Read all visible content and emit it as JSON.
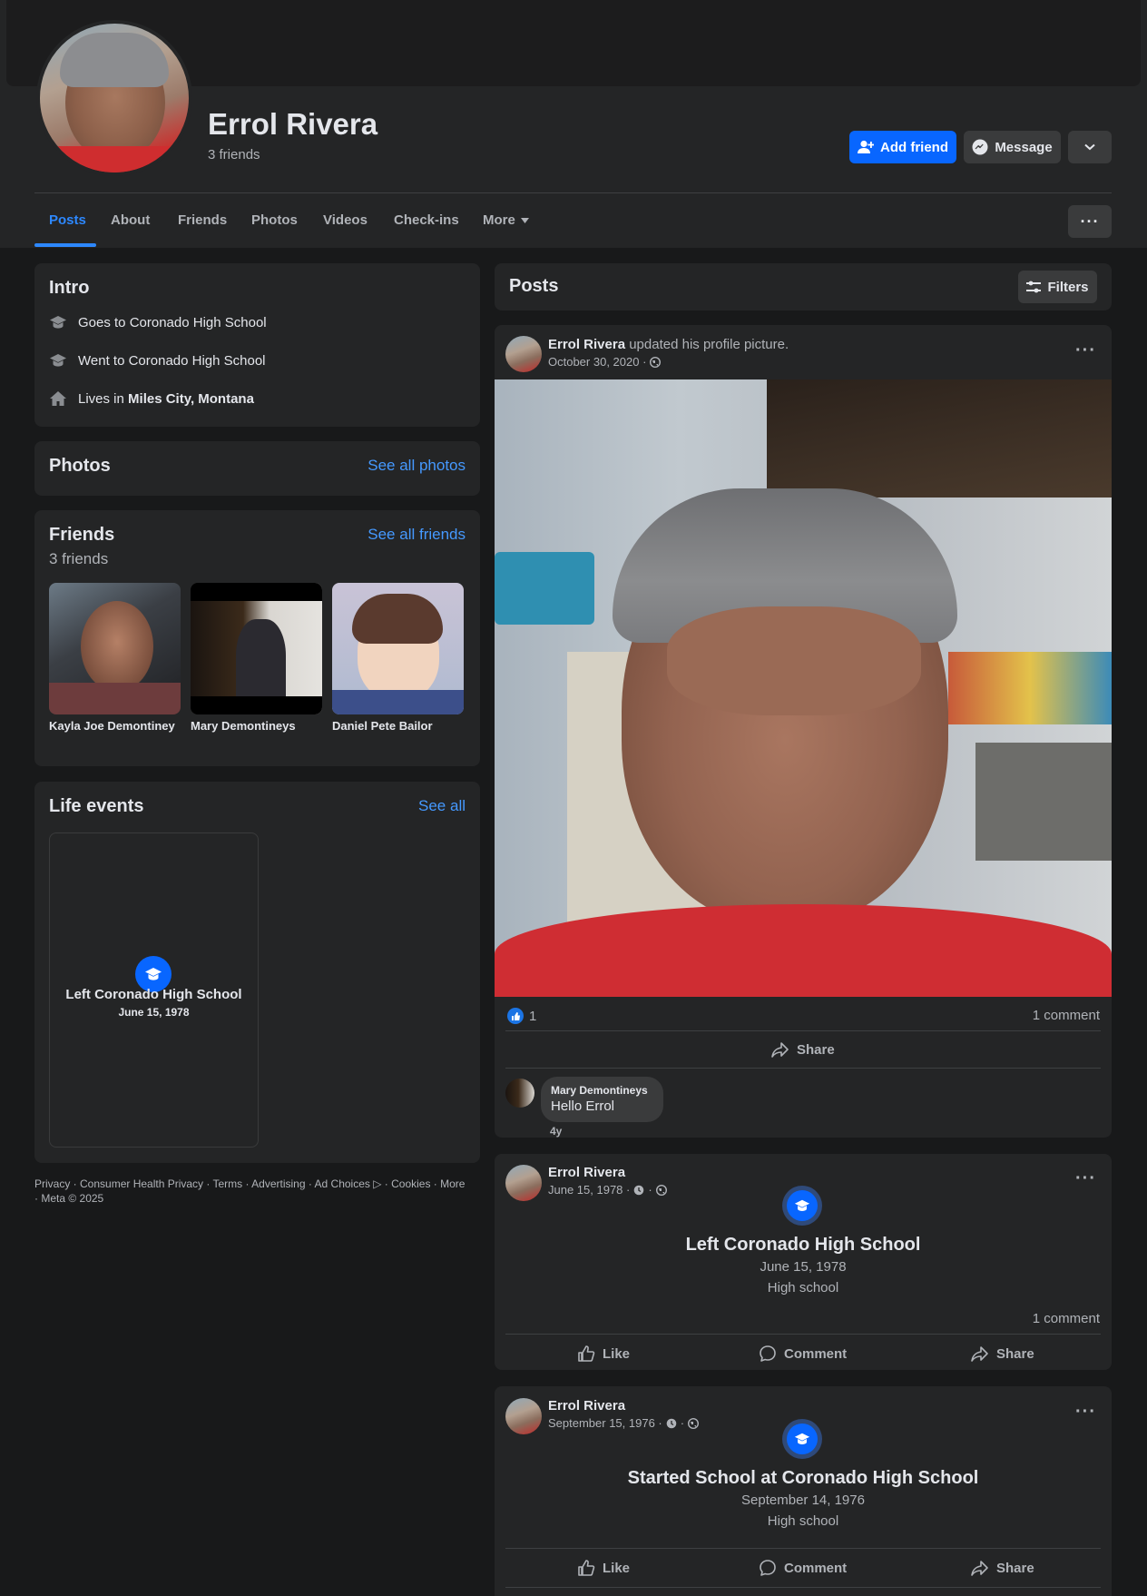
{
  "profile": {
    "name": "Errol Rivera",
    "friends_count": "3 friends"
  },
  "actions": {
    "add_friend": "Add friend",
    "message": "Message"
  },
  "tabs": [
    "Posts",
    "About",
    "Friends",
    "Photos",
    "Videos",
    "Check-ins",
    "More"
  ],
  "intro": {
    "title": "Intro",
    "items": [
      {
        "icon": "graduation-cap-icon",
        "text": "Goes to Coronado High School"
      },
      {
        "icon": "graduation-cap-icon",
        "text": "Went to Coronado High School"
      },
      {
        "icon": "home-icon",
        "prefix": "Lives in ",
        "bold": "Miles City, Montana"
      }
    ]
  },
  "photos": {
    "title": "Photos",
    "link": "See all photos"
  },
  "friends": {
    "title": "Friends",
    "link": "See all friends",
    "count": "3 friends",
    "list": [
      "Kayla Joe Demontiney",
      "Mary Demontineys",
      "Daniel Pete Bailor"
    ]
  },
  "life_events": {
    "title": "Life events",
    "link": "See all",
    "event_title": "Left Coronado High School",
    "event_date": "June 15, 1978"
  },
  "footer": {
    "text": "Privacy · Consumer Health Privacy · Terms · Advertising · Ad Choices ▷ · Cookies · More · Meta © 2025"
  },
  "posts_header": {
    "title": "Posts",
    "filters": "Filters"
  },
  "post1": {
    "author": "Errol Rivera",
    "action": " updated his profile picture.",
    "date": "October 30, 2020 ·",
    "likes": "1",
    "comments": "1 comment",
    "share": "Share",
    "comment": {
      "author": "Mary Demontineys",
      "text": "Hello Errol",
      "age": "4y"
    }
  },
  "post2": {
    "author": "Errol Rivera",
    "date": "June 15, 1978 ·",
    "dot": "·",
    "title": "Left Coronado High School",
    "event_date": "June 15, 1978",
    "category": "High school",
    "comments": "1 comment",
    "like": "Like",
    "comment": "Comment",
    "share": "Share"
  },
  "post3": {
    "author": "Errol Rivera",
    "date": "September 15, 1976 ·",
    "dot": "·",
    "title": "Started School at Coronado High School",
    "event_date": "September 14, 1976",
    "category": "High school",
    "like": "Like",
    "comment": "Comment",
    "share": "Share"
  },
  "colors": {
    "background": "#18191a",
    "card": "#242526",
    "accent": "#0866ff",
    "link": "#4599ff",
    "text_secondary": "#b0b3b8"
  }
}
